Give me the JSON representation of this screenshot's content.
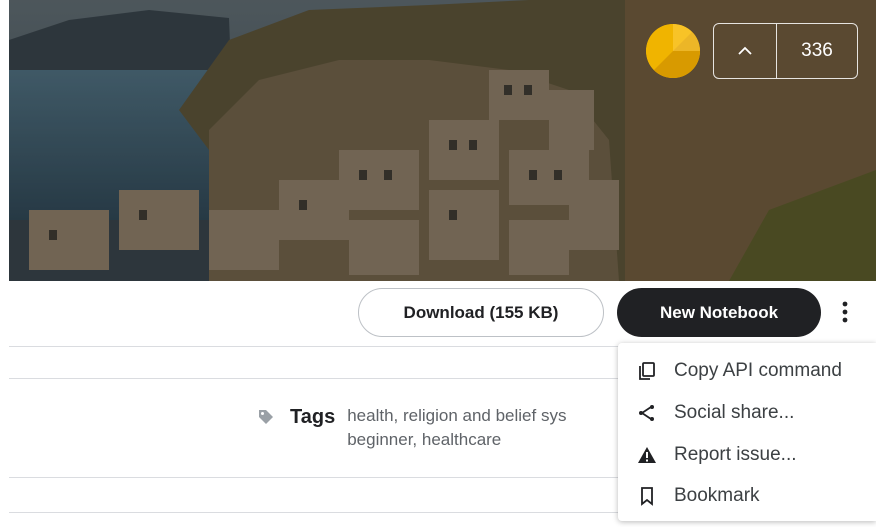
{
  "hero": {
    "image": "coastal-village-photo"
  },
  "vote": {
    "count": "336"
  },
  "actions": {
    "download_label": "Download (155 KB)",
    "notebook_label": "New Notebook"
  },
  "tags": {
    "label": "Tags",
    "line1": "health, religion and belief sys",
    "line2": "beginner, healthcare"
  },
  "menu": {
    "items": [
      {
        "icon": "copy-icon",
        "label": "Copy API command"
      },
      {
        "icon": "share-icon",
        "label": "Social share..."
      },
      {
        "icon": "warning-icon",
        "label": "Report issue..."
      },
      {
        "icon": "bookmark-icon",
        "label": "Bookmark"
      }
    ]
  },
  "colors": {
    "badge": "#f0b400",
    "primary_button": "#202124",
    "divider": "#dadce0"
  }
}
